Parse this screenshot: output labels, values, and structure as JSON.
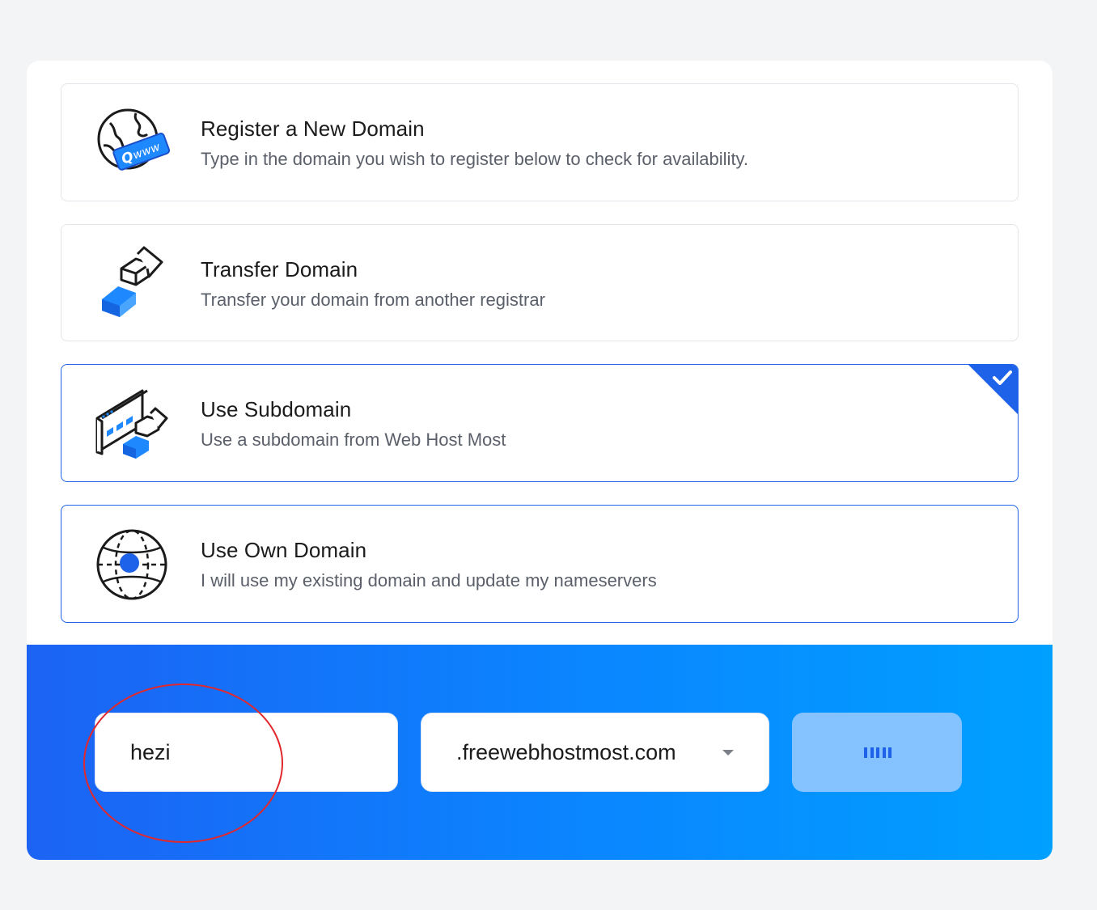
{
  "options": [
    {
      "title": "Register a New Domain",
      "description": "Type in the domain you wish to register below to check for availability.",
      "icon": "globe-www-search-icon"
    },
    {
      "title": "Transfer Domain",
      "description": "Transfer your domain from another registrar",
      "icon": "transfer-arrow-icon"
    },
    {
      "title": "Use Subdomain",
      "description": "Use a subdomain from Web Host Most",
      "icon": "browser-window-arrow-icon",
      "selected": true
    },
    {
      "title": "Use Own Domain",
      "description": "I will use my existing domain and update my nameservers",
      "icon": "globe-target-icon"
    }
  ],
  "form": {
    "subdomain_value": "hezi",
    "tld_selected": ".freewebhostmost.com",
    "submit_state": "loading"
  },
  "colors": {
    "accent": "#1d62e8",
    "icon_blue": "#1e88ff",
    "gradient_start": "#1c63f4",
    "gradient_end": "#00a0ff",
    "button_loading_bg": "#84c3ff",
    "annotation": "#e0282d"
  }
}
